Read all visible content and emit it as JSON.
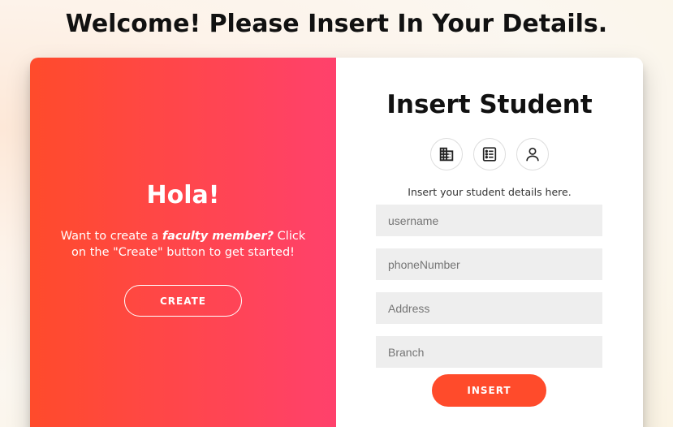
{
  "header": {
    "title": "Welcome! Please Insert In Your Details."
  },
  "overlay_panel": {
    "heading": "Hola!",
    "text_before": "Want to create a ",
    "text_emphasis": "faculty member?",
    "text_after": " Click on the \"Create\" button to get started!",
    "create_label": "CREATE"
  },
  "form": {
    "title": "Insert Student",
    "icons": [
      "building-icon",
      "list-icon",
      "user-icon"
    ],
    "hint": "Insert your student details here.",
    "fields": [
      {
        "placeholder": "username",
        "value": ""
      },
      {
        "placeholder": "phoneNumber",
        "value": ""
      },
      {
        "placeholder": "Address",
        "value": ""
      },
      {
        "placeholder": "Branch",
        "value": ""
      }
    ],
    "insert_label": "INSERT"
  },
  "colors": {
    "accent": "#ff4b2b",
    "gradient_end": "#ff416c"
  }
}
